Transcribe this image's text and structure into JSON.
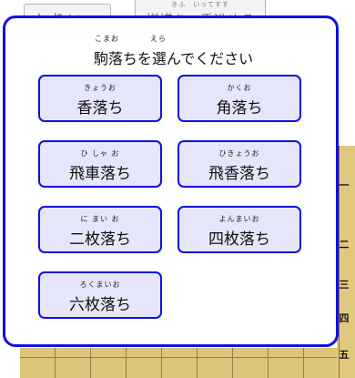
{
  "background": {
    "button1": {
      "label": "とりいっ"
    },
    "button2": {
      "ruby": "きふ　いってすす",
      "label": "棋譜を一手進ゆる"
    },
    "board_ranks": [
      "一",
      "二",
      "三",
      "四",
      "五"
    ]
  },
  "dialog": {
    "title": "駒落ちを選んでください",
    "title_ruby": [
      "こまお",
      "えら"
    ],
    "options": [
      {
        "label": "香落ち",
        "ruby": "きょうお"
      },
      {
        "label": "角落ち",
        "ruby": "かくお"
      },
      {
        "label": "飛車落ち",
        "ruby": "ひ しゃ お"
      },
      {
        "label": "飛香落ち",
        "ruby": "ひきょうお"
      },
      {
        "label": "二枚落ち",
        "ruby": "に まい お"
      },
      {
        "label": "四枚落ち",
        "ruby": "よんまいお"
      },
      {
        "label": "六枚落ち",
        "ruby": "ろくまいお"
      }
    ]
  }
}
